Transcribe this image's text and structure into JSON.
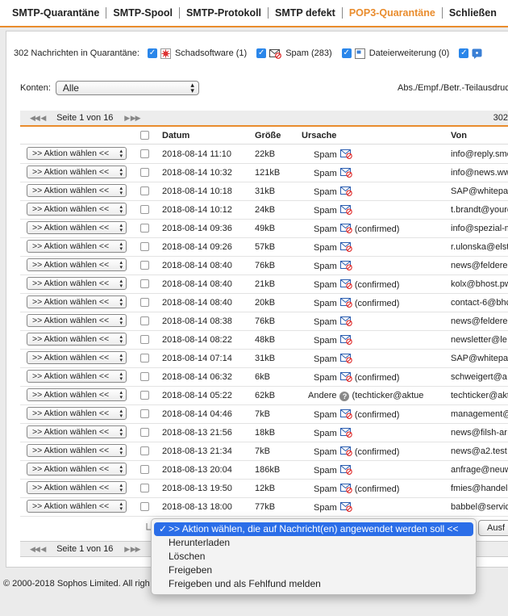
{
  "tabs": [
    {
      "label": "SMTP-Quarantäne",
      "active": false
    },
    {
      "label": "SMTP-Spool",
      "active": false
    },
    {
      "label": "SMTP-Protokoll",
      "active": false
    },
    {
      "label": "SMTP defekt",
      "active": false
    },
    {
      "label": "POP3-Quarantäne",
      "active": true
    },
    {
      "label": "Schließen",
      "active": false
    }
  ],
  "filters": {
    "count_label": "302 Nachrichten in Quarantäne:",
    "malware": "Schadsoftware (1)",
    "spam": "Spam (283)",
    "extension": "Dateierweiterung (0)"
  },
  "accounts": {
    "label": "Konten:",
    "value": "Alle"
  },
  "search_label": "Abs./Empf./Betr.-Teilausdruck",
  "pager": {
    "top_text": "Seite 1 von 16",
    "bottom_text": "Seite 1 von 16",
    "top_count": "302"
  },
  "columns": {
    "date": "Datum",
    "size": "Größe",
    "reason": "Ursache",
    "from": "Von"
  },
  "action_select_label": ">> Aktion wählen <<",
  "rows": [
    {
      "date": "2018-08-14 11:10",
      "size": "22kB",
      "reason": "Spam",
      "note": "",
      "from": "info@reply.smeet"
    },
    {
      "date": "2018-08-14 10:32",
      "size": "121kB",
      "reason": "Spam",
      "note": "",
      "from": "info@news.www"
    },
    {
      "date": "2018-08-14 10:18",
      "size": "31kB",
      "reason": "Spam",
      "note": "",
      "from": "SAP@whitepaper"
    },
    {
      "date": "2018-08-14 10:12",
      "size": "24kB",
      "reason": "Spam",
      "note": "",
      "from": "t.brandt@yourc"
    },
    {
      "date": "2018-08-14 09:36",
      "size": "49kB",
      "reason": "Spam",
      "note": "(confirmed)",
      "from": "info@spezial-m"
    },
    {
      "date": "2018-08-14 09:26",
      "size": "57kB",
      "reason": "Spam",
      "note": "",
      "from": "r.ulonska@elst"
    },
    {
      "date": "2018-08-14 08:40",
      "size": "76kB",
      "reason": "Spam",
      "note": "",
      "from": "news@felderer"
    },
    {
      "date": "2018-08-14 08:40",
      "size": "21kB",
      "reason": "Spam",
      "note": "(confirmed)",
      "from": "kolx@bhost.pw"
    },
    {
      "date": "2018-08-14 08:40",
      "size": "20kB",
      "reason": "Spam",
      "note": "(confirmed)",
      "from": "contact-6@bhc"
    },
    {
      "date": "2018-08-14 08:38",
      "size": "76kB",
      "reason": "Spam",
      "note": "",
      "from": "news@felderer"
    },
    {
      "date": "2018-08-14 08:22",
      "size": "48kB",
      "reason": "Spam",
      "note": "",
      "from": "newsletter@le"
    },
    {
      "date": "2018-08-14 07:14",
      "size": "31kB",
      "reason": "Spam",
      "note": "",
      "from": "SAP@whitepap"
    },
    {
      "date": "2018-08-14 06:32",
      "size": "6kB",
      "reason": "Spam",
      "note": "(confirmed)",
      "from": "schweigert@a"
    },
    {
      "date": "2018-08-14 05:22",
      "size": "62kB",
      "reason": "Andere",
      "note": "(techticker@aktue",
      "from": "techticker@akt",
      "other": true
    },
    {
      "date": "2018-08-14 04:46",
      "size": "7kB",
      "reason": "Spam",
      "note": "(confirmed)",
      "from": "management@"
    },
    {
      "date": "2018-08-13 21:56",
      "size": "18kB",
      "reason": "Spam",
      "note": "",
      "from": "news@filsh-ar"
    },
    {
      "date": "2018-08-13 21:34",
      "size": "7kB",
      "reason": "Spam",
      "note": "(confirmed)",
      "from": "news@a2.test"
    },
    {
      "date": "2018-08-13 20:04",
      "size": "186kB",
      "reason": "Spam",
      "note": "",
      "from": "anfrage@neuw"
    },
    {
      "date": "2018-08-13 19:50",
      "size": "12kB",
      "reason": "Spam",
      "note": "(confirmed)",
      "from": "fmies@handel"
    },
    {
      "date": "2018-08-13 18:00",
      "size": "77kB",
      "reason": "Spam",
      "note": "",
      "from": "babbel@servic"
    }
  ],
  "bulk_dropdown": {
    "selected": ">> Aktion wählen, die auf Nachricht(en) angewendet werden soll <<",
    "options": [
      "Herunterladen",
      "Löschen",
      "Freigeben",
      "Freigeben und als Fehlfund melden"
    ]
  },
  "apply_button": "Ausf",
  "footer": "© 2000-2018 Sophos Limited. All righ",
  "colors": {
    "accent": "#e98c2d",
    "checkbox": "#2a86ea",
    "selection": "#2b6ee8"
  }
}
